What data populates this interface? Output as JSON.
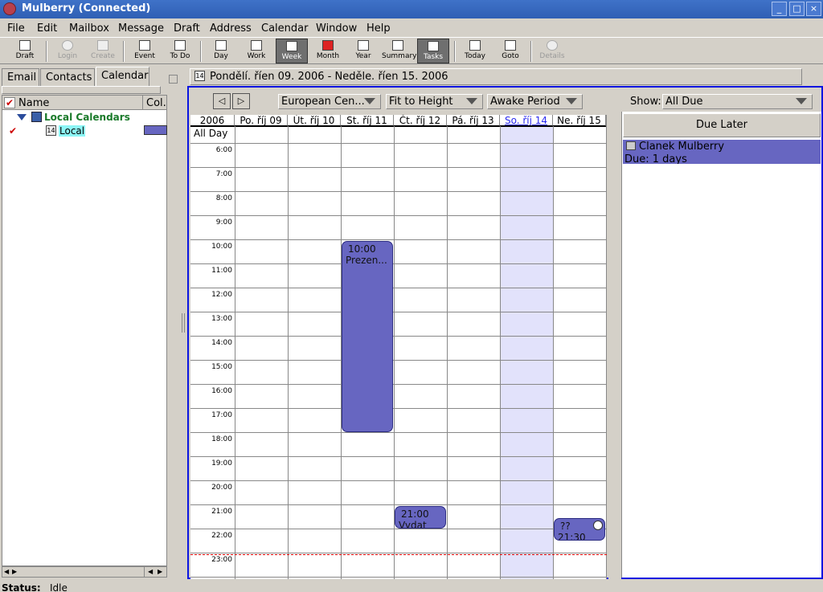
{
  "window": {
    "title": "Mulberry (Connected)"
  },
  "menu": [
    "File",
    "Edit",
    "Mailbox",
    "Message",
    "Draft",
    "Address",
    "Calendar",
    "Window",
    "Help"
  ],
  "toolbar": {
    "draft": "Draft",
    "login": "Login",
    "create": "Create",
    "event": "Event",
    "todo": "To Do",
    "day": "Day",
    "work": "Work",
    "week": "Week",
    "month": "Month",
    "year": "Year",
    "summary": "Summary",
    "tasks": "Tasks",
    "today": "Today",
    "goto": "Goto",
    "details": "Details"
  },
  "tabs": {
    "email": "Email",
    "contacts": "Contacts",
    "calendar": "Calendar"
  },
  "calendar_list": {
    "col_name": "Name",
    "col_color": "Col.",
    "group": "Local Calendars",
    "item": "Local",
    "icon_day": "14",
    "item_color": "#6766c1"
  },
  "range": {
    "text": "Pondělí. říen 09. 2006 - Neděle. říen 15. 2006",
    "icon_day": "14"
  },
  "view": {
    "timezone": "European Cen...",
    "fit": "Fit to Height",
    "period": "Awake Period",
    "show_label": "Show:",
    "show_value": "All Due"
  },
  "week": {
    "year": "2006",
    "all_day": "All Day",
    "days": [
      "Po. říj 09",
      "Út. říj 10",
      "St. říj 11",
      "Čt. říj 12",
      "Pá. říj 13",
      "So. říj 14",
      "Ne. říj 15"
    ],
    "today_index": 5
  },
  "times": [
    "6:00",
    "7:00",
    "8:00",
    "9:00",
    "10:00",
    "11:00",
    "12:00",
    "13:00",
    "14:00",
    "15:00",
    "16:00",
    "17:00",
    "18:00",
    "19:00",
    "20:00",
    "21:00",
    "22:00",
    "23:00"
  ],
  "events": [
    {
      "time": "10:00",
      "title": "Prezen...",
      "day": 2,
      "start": 10,
      "end": 18
    },
    {
      "time": "21:00",
      "title": "Vydat",
      "day": 3,
      "start": 21,
      "end": 22
    },
    {
      "time": "??",
      "title": "21:30",
      "day": 6,
      "start": 21.5,
      "end": 22.5,
      "alarm": true
    }
  ],
  "tasks": {
    "header": "Due Later",
    "items": [
      {
        "title": "Clanek Mulberry",
        "due": "Due: 1 days"
      }
    ]
  },
  "status": {
    "label": "Status:",
    "value": "Idle"
  }
}
